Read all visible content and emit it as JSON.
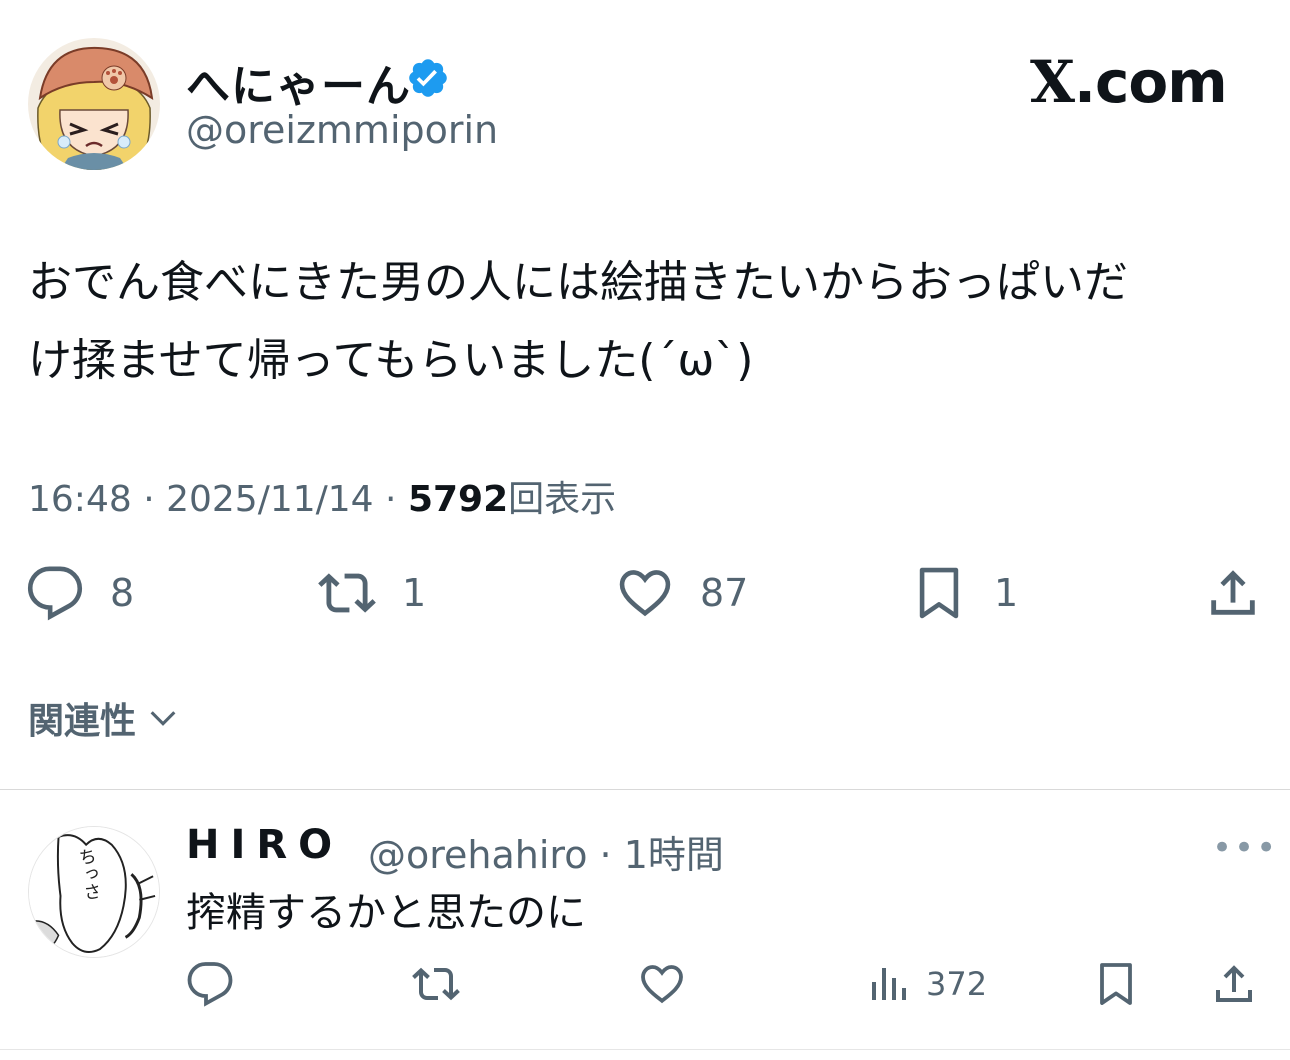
{
  "header": {
    "display_name": "へにゃーん",
    "handle": "@oreizmmiporin",
    "brand": {
      "x": "X",
      "domain": ".com"
    },
    "verified_color": "#1d9bf0"
  },
  "tweet": {
    "text": "おでん食べにきた男の人には絵描きたいからおっぱいだ\nけ揉ませて帰ってもらいました(´ω`)",
    "time": "16:48",
    "date": "2025/11/14",
    "views_count": "5792",
    "views_label": "回表示",
    "sep": " · "
  },
  "actions": {
    "replies": "8",
    "reposts": "1",
    "likes": "87",
    "bookmarks": "1"
  },
  "sort": {
    "label": "関連性"
  },
  "reply": {
    "display_name": "HIRO",
    "handle": "@orehahiro",
    "time": "1時間",
    "text": "搾精するかと思たのに",
    "views": "372",
    "avatar_text": "ちっさ"
  },
  "icons": [
    "verified-badge-icon",
    "reply-icon",
    "repost-icon",
    "like-icon",
    "bookmark-icon",
    "share-icon",
    "chevron-down-icon",
    "views-icon",
    "more-icon"
  ]
}
